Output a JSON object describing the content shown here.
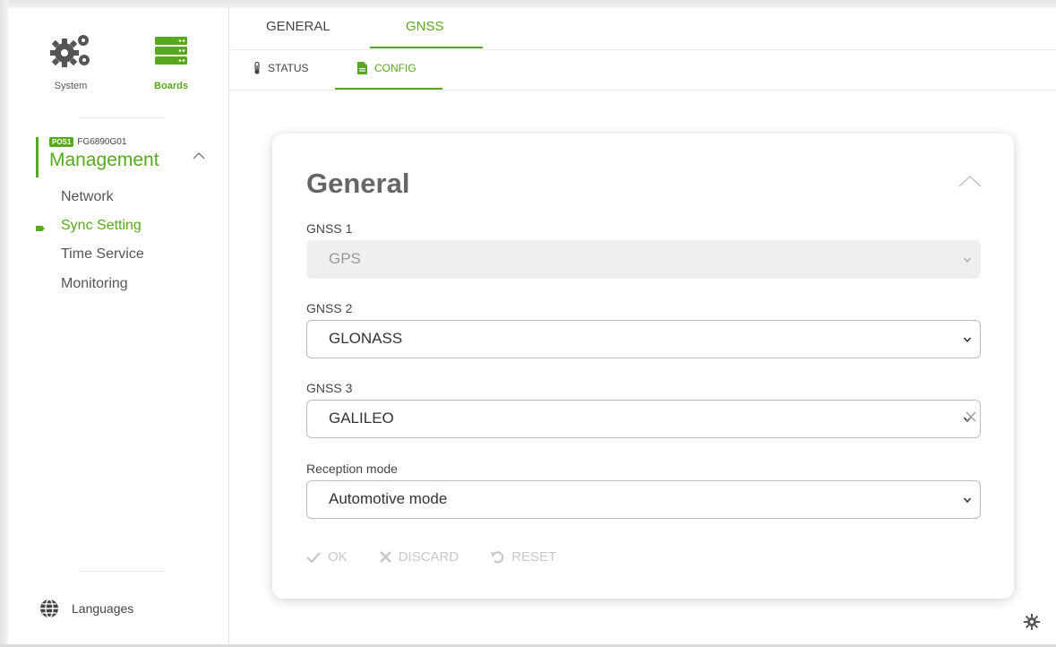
{
  "sidebar": {
    "system_label": "System",
    "boards_label": "Boards",
    "position_badge": "POS1",
    "board_id": "FG6890G01",
    "section_title": "Management",
    "items": [
      {
        "label": "Network"
      },
      {
        "label": "Sync Setting"
      },
      {
        "label": "Time Service"
      },
      {
        "label": "Monitoring"
      }
    ],
    "languages_label": "Languages"
  },
  "tabs": [
    {
      "label": "GENERAL"
    },
    {
      "label": "GNSS"
    }
  ],
  "subtabs": [
    {
      "label": "STATUS"
    },
    {
      "label": "CONFIG"
    }
  ],
  "card": {
    "title": "General",
    "gnss1_label": "GNSS 1",
    "gnss1_value": "GPS",
    "gnss2_label": "GNSS 2",
    "gnss2_value": "GLONASS",
    "gnss3_label": "GNSS 3",
    "gnss3_value": "GALILEO",
    "reception_label": "Reception mode",
    "reception_value": "Automotive mode"
  },
  "actions": {
    "ok_label": "OK",
    "discard_label": "DISCARD",
    "reset_label": "RESET"
  },
  "colors": {
    "accent": "#58a81c",
    "disabled_text": "#c8c8c8"
  },
  "icons": [
    "gears-icon",
    "server-stack-icon",
    "chevron-up-icon",
    "bullet-arrow-icon",
    "globe-icon",
    "thermometer-icon",
    "document-icon",
    "chevron-down-icon",
    "close-icon",
    "check-icon",
    "reset-icon",
    "gear-icon"
  ]
}
